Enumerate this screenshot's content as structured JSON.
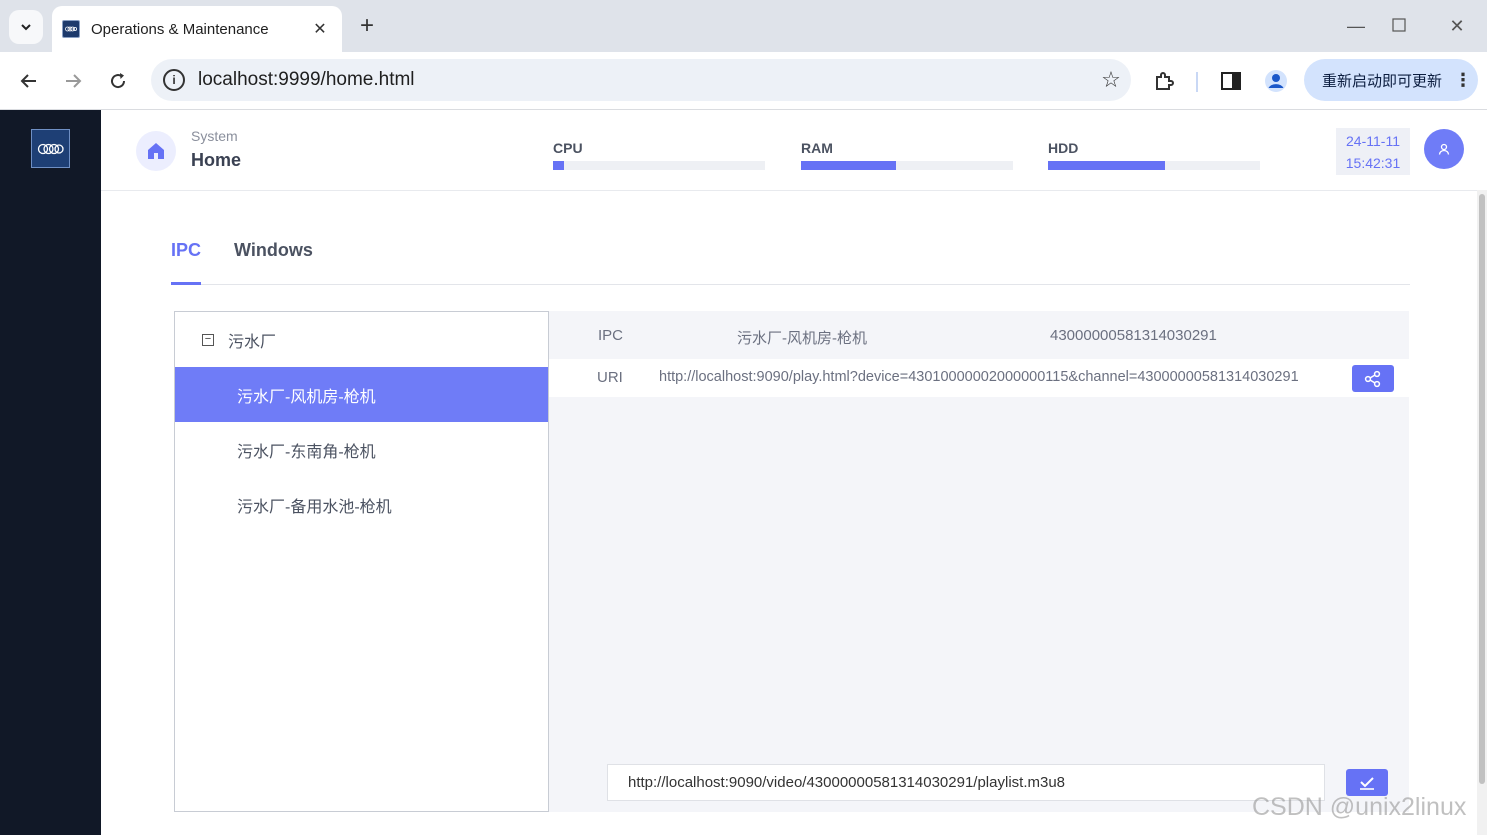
{
  "browser": {
    "tab_title": "Operations & Maintenance",
    "url": "localhost:9999/home.html",
    "update_button": "重新启动即可更新"
  },
  "header": {
    "breadcrumb_parent": "System",
    "breadcrumb_current": "Home",
    "meters": [
      {
        "label": "CPU",
        "value": 0.05
      },
      {
        "label": "RAM",
        "value": 0.45
      },
      {
        "label": "HDD",
        "value": 0.55
      }
    ],
    "date": "24-11-11",
    "time": "15:42:31"
  },
  "tabs": [
    {
      "label": "IPC",
      "active": true
    },
    {
      "label": "Windows",
      "active": false
    }
  ],
  "tree": {
    "group": "污水厂",
    "items": [
      {
        "label": "污水厂-风机房-枪机",
        "selected": true
      },
      {
        "label": "污水厂-东南角-枪机",
        "selected": false
      },
      {
        "label": "污水厂-备用水池-枪机",
        "selected": false
      }
    ]
  },
  "detail": {
    "ipc_label": "IPC",
    "ipc_name": "污水厂-风机房-枪机",
    "ipc_id": "43000000581314030291",
    "uri_label": "URI",
    "uri_value": "http://localhost:9090/play.html?device=43010000002000000115&channel=43000000581314030291",
    "playlist_value": "http://localhost:9090/video/43000000581314030291/playlist.m3u8"
  },
  "colors": {
    "accent": "#6672f5",
    "sidebar": "#111827"
  },
  "watermark": "CSDN @unix2linux"
}
